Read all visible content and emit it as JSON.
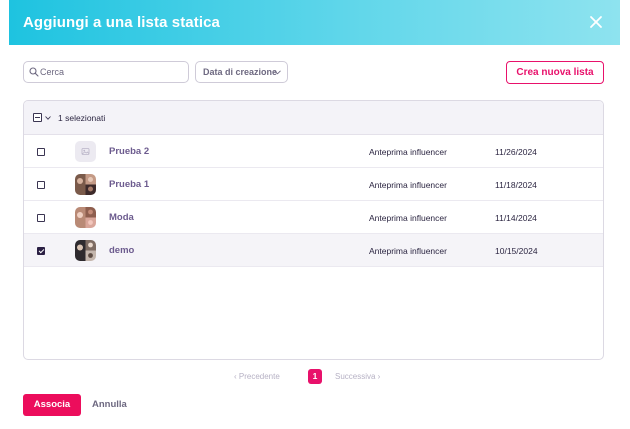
{
  "dialog": {
    "title": "Aggiungi a una lista statica",
    "accent_color": "#e8116b",
    "header_gradient": [
      "#1ec3e0",
      "#8ee3ef"
    ]
  },
  "toolbar": {
    "search_placeholder": "Cerca",
    "search_value": "",
    "sort_label": "Data di creazione",
    "create_button_label": "Crea nuova lista"
  },
  "table": {
    "selected_count_label": "1 selezionati",
    "rows": [
      {
        "name": "Prueba 2",
        "type": "Anteprima influencer",
        "date": "11/26/2024",
        "checked": false,
        "avatar": "placeholder"
      },
      {
        "name": "Prueba 1",
        "type": "Anteprima influencer",
        "date": "11/18/2024",
        "checked": false,
        "avatar": "photos"
      },
      {
        "name": "Moda",
        "type": "Anteprima influencer",
        "date": "11/14/2024",
        "checked": false,
        "avatar": "photos"
      },
      {
        "name": "demo",
        "type": "Anteprima influencer",
        "date": "10/15/2024",
        "checked": true,
        "avatar": "photos"
      }
    ]
  },
  "pagination": {
    "prev_label": "‹ Precedente",
    "current_page": "1",
    "next_label": "Successiva ›"
  },
  "footer": {
    "primary_label": "Associa",
    "secondary_label": "Annulla"
  }
}
